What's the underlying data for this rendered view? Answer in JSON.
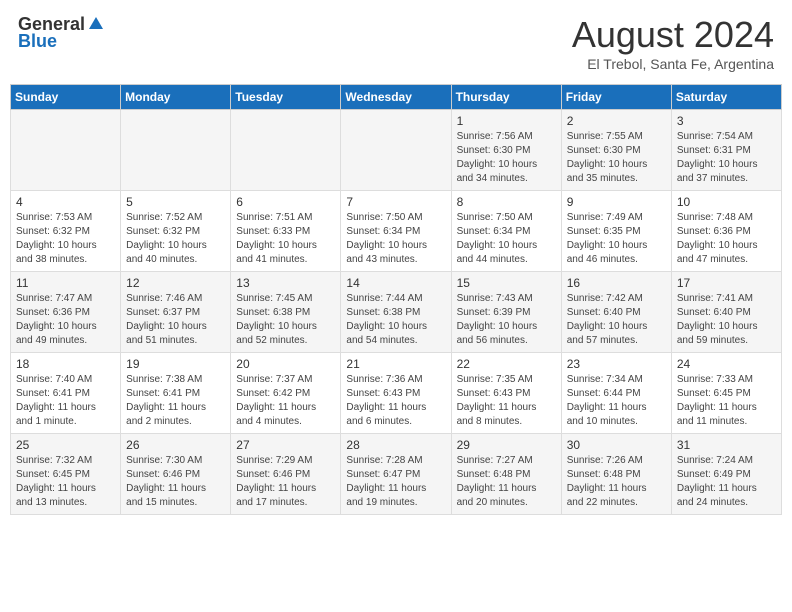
{
  "header": {
    "logo_general": "General",
    "logo_blue": "Blue",
    "month_title": "August 2024",
    "location": "El Trebol, Santa Fe, Argentina"
  },
  "days_of_week": [
    "Sunday",
    "Monday",
    "Tuesday",
    "Wednesday",
    "Thursday",
    "Friday",
    "Saturday"
  ],
  "weeks": [
    {
      "days": [
        {
          "number": "",
          "content": ""
        },
        {
          "number": "",
          "content": ""
        },
        {
          "number": "",
          "content": ""
        },
        {
          "number": "",
          "content": ""
        },
        {
          "number": "1",
          "content": "Sunrise: 7:56 AM\nSunset: 6:30 PM\nDaylight: 10 hours and 34 minutes."
        },
        {
          "number": "2",
          "content": "Sunrise: 7:55 AM\nSunset: 6:30 PM\nDaylight: 10 hours and 35 minutes."
        },
        {
          "number": "3",
          "content": "Sunrise: 7:54 AM\nSunset: 6:31 PM\nDaylight: 10 hours and 37 minutes."
        }
      ]
    },
    {
      "days": [
        {
          "number": "4",
          "content": "Sunrise: 7:53 AM\nSunset: 6:32 PM\nDaylight: 10 hours and 38 minutes."
        },
        {
          "number": "5",
          "content": "Sunrise: 7:52 AM\nSunset: 6:32 PM\nDaylight: 10 hours and 40 minutes."
        },
        {
          "number": "6",
          "content": "Sunrise: 7:51 AM\nSunset: 6:33 PM\nDaylight: 10 hours and 41 minutes."
        },
        {
          "number": "7",
          "content": "Sunrise: 7:50 AM\nSunset: 6:34 PM\nDaylight: 10 hours and 43 minutes."
        },
        {
          "number": "8",
          "content": "Sunrise: 7:50 AM\nSunset: 6:34 PM\nDaylight: 10 hours and 44 minutes."
        },
        {
          "number": "9",
          "content": "Sunrise: 7:49 AM\nSunset: 6:35 PM\nDaylight: 10 hours and 46 minutes."
        },
        {
          "number": "10",
          "content": "Sunrise: 7:48 AM\nSunset: 6:36 PM\nDaylight: 10 hours and 47 minutes."
        }
      ]
    },
    {
      "days": [
        {
          "number": "11",
          "content": "Sunrise: 7:47 AM\nSunset: 6:36 PM\nDaylight: 10 hours and 49 minutes."
        },
        {
          "number": "12",
          "content": "Sunrise: 7:46 AM\nSunset: 6:37 PM\nDaylight: 10 hours and 51 minutes."
        },
        {
          "number": "13",
          "content": "Sunrise: 7:45 AM\nSunset: 6:38 PM\nDaylight: 10 hours and 52 minutes."
        },
        {
          "number": "14",
          "content": "Sunrise: 7:44 AM\nSunset: 6:38 PM\nDaylight: 10 hours and 54 minutes."
        },
        {
          "number": "15",
          "content": "Sunrise: 7:43 AM\nSunset: 6:39 PM\nDaylight: 10 hours and 56 minutes."
        },
        {
          "number": "16",
          "content": "Sunrise: 7:42 AM\nSunset: 6:40 PM\nDaylight: 10 hours and 57 minutes."
        },
        {
          "number": "17",
          "content": "Sunrise: 7:41 AM\nSunset: 6:40 PM\nDaylight: 10 hours and 59 minutes."
        }
      ]
    },
    {
      "days": [
        {
          "number": "18",
          "content": "Sunrise: 7:40 AM\nSunset: 6:41 PM\nDaylight: 11 hours and 1 minute."
        },
        {
          "number": "19",
          "content": "Sunrise: 7:38 AM\nSunset: 6:41 PM\nDaylight: 11 hours and 2 minutes."
        },
        {
          "number": "20",
          "content": "Sunrise: 7:37 AM\nSunset: 6:42 PM\nDaylight: 11 hours and 4 minutes."
        },
        {
          "number": "21",
          "content": "Sunrise: 7:36 AM\nSunset: 6:43 PM\nDaylight: 11 hours and 6 minutes."
        },
        {
          "number": "22",
          "content": "Sunrise: 7:35 AM\nSunset: 6:43 PM\nDaylight: 11 hours and 8 minutes."
        },
        {
          "number": "23",
          "content": "Sunrise: 7:34 AM\nSunset: 6:44 PM\nDaylight: 11 hours and 10 minutes."
        },
        {
          "number": "24",
          "content": "Sunrise: 7:33 AM\nSunset: 6:45 PM\nDaylight: 11 hours and 11 minutes."
        }
      ]
    },
    {
      "days": [
        {
          "number": "25",
          "content": "Sunrise: 7:32 AM\nSunset: 6:45 PM\nDaylight: 11 hours and 13 minutes."
        },
        {
          "number": "26",
          "content": "Sunrise: 7:30 AM\nSunset: 6:46 PM\nDaylight: 11 hours and 15 minutes."
        },
        {
          "number": "27",
          "content": "Sunrise: 7:29 AM\nSunset: 6:46 PM\nDaylight: 11 hours and 17 minutes."
        },
        {
          "number": "28",
          "content": "Sunrise: 7:28 AM\nSunset: 6:47 PM\nDaylight: 11 hours and 19 minutes."
        },
        {
          "number": "29",
          "content": "Sunrise: 7:27 AM\nSunset: 6:48 PM\nDaylight: 11 hours and 20 minutes."
        },
        {
          "number": "30",
          "content": "Sunrise: 7:26 AM\nSunset: 6:48 PM\nDaylight: 11 hours and 22 minutes."
        },
        {
          "number": "31",
          "content": "Sunrise: 7:24 AM\nSunset: 6:49 PM\nDaylight: 11 hours and 24 minutes."
        }
      ]
    }
  ]
}
